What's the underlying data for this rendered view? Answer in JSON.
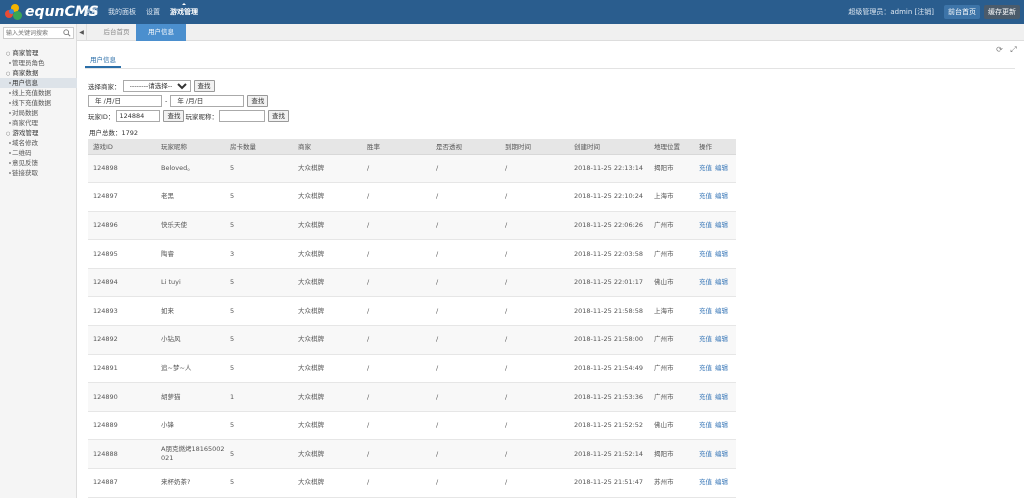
{
  "app": {
    "brand": "equnCMS",
    "topnav": [
      "常用",
      "我的面板",
      "设置",
      "游戏管理"
    ],
    "topnav_active": 3,
    "admin_text": "超级管理员：admin [注销]",
    "btn_home": "前台首页",
    "btn_update": "缓存更新"
  },
  "sidebar": {
    "search_placeholder": "输入关键词搜索",
    "menu": [
      {
        "type": "group",
        "label": "商家管理"
      },
      {
        "type": "item",
        "label": "管理员角色"
      },
      {
        "type": "group",
        "label": "商家数据"
      },
      {
        "type": "item",
        "label": "用户信息",
        "active": true
      },
      {
        "type": "item",
        "label": "线上充值数据"
      },
      {
        "type": "item",
        "label": "线下充值数据"
      },
      {
        "type": "item",
        "label": "对局数据"
      },
      {
        "type": "item",
        "label": "商家代理"
      },
      {
        "type": "group",
        "label": "游戏管理"
      },
      {
        "type": "item",
        "label": "域名修改"
      },
      {
        "type": "item",
        "label": "二维码"
      },
      {
        "type": "item",
        "label": "意见反馈"
      },
      {
        "type": "item",
        "label": "链接获取"
      }
    ]
  },
  "tabs": {
    "home": "后台首页",
    "current": "用户信息",
    "close": "×"
  },
  "page": {
    "subtab": "用户信息",
    "select_label": "选择商家：",
    "select_value": "--------请选择--------",
    "search_btn": "查找",
    "date_placeholder": "年 /月/日",
    "date_sep": "-",
    "pid_label": "玩家ID：",
    "pid_value": "124884",
    "pname_label": "玩家昵称：",
    "pname_value": "",
    "total": "用户总数：1792"
  },
  "table": {
    "headers": [
      "游戏ID",
      "玩家昵称",
      "房卡数量",
      "商家",
      "胜率",
      "是否透视",
      "到期时间",
      "创建时间",
      "地理位置",
      "操作"
    ],
    "ops": [
      "充值",
      "编辑"
    ],
    "rows": [
      [
        "124898",
        "Beloved。",
        "5",
        "大众棋牌",
        "/",
        "/",
        "/",
        "2018-11-25 22:13:14",
        "揭阳市"
      ],
      [
        "124897",
        "老黑",
        "5",
        "大众棋牌",
        "/",
        "/",
        "/",
        "2018-11-25 22:10:24",
        "上海市"
      ],
      [
        "124896",
        "快乐天使",
        "5",
        "大众棋牌",
        "/",
        "/",
        "/",
        "2018-11-25 22:06:26",
        "广州市"
      ],
      [
        "124895",
        "陶睿",
        "3",
        "大众棋牌",
        "/",
        "/",
        "/",
        "2018-11-25 22:03:58",
        "广州市"
      ],
      [
        "124894",
        "Li tuyi",
        "5",
        "大众棋牌",
        "/",
        "/",
        "/",
        "2018-11-25 22:01:17",
        "佛山市"
      ],
      [
        "124893",
        "如来",
        "5",
        "大众棋牌",
        "/",
        "/",
        "/",
        "2018-11-25 21:58:58",
        "上海市"
      ],
      [
        "124892",
        "小钻风",
        "5",
        "大众棋牌",
        "/",
        "/",
        "/",
        "2018-11-25 21:58:00",
        "广州市"
      ],
      [
        "124891",
        "追~梦~人",
        "5",
        "大众棋牌",
        "/",
        "/",
        "/",
        "2018-11-25 21:54:49",
        "广州市"
      ],
      [
        "124890",
        "胡萝猫",
        "1",
        "大众棋牌",
        "/",
        "/",
        "/",
        "2018-11-25 21:53:36",
        "广州市"
      ],
      [
        "124889",
        "小锋",
        "5",
        "大众棋牌",
        "/",
        "/",
        "/",
        "2018-11-25 21:52:52",
        "佛山市"
      ],
      [
        "124888",
        "A朋克燃烤18165002021",
        "5",
        "大众棋牌",
        "/",
        "/",
        "/",
        "2018-11-25 21:52:14",
        "揭阳市"
      ],
      [
        "124887",
        "来杯奶茶?",
        "5",
        "大众棋牌",
        "/",
        "/",
        "/",
        "2018-11-25 21:51:47",
        "苏州市"
      ]
    ]
  },
  "colors": {
    "topbar": "#2a5d8e",
    "accent": "#4b8fce",
    "link": "#3a78b8"
  }
}
